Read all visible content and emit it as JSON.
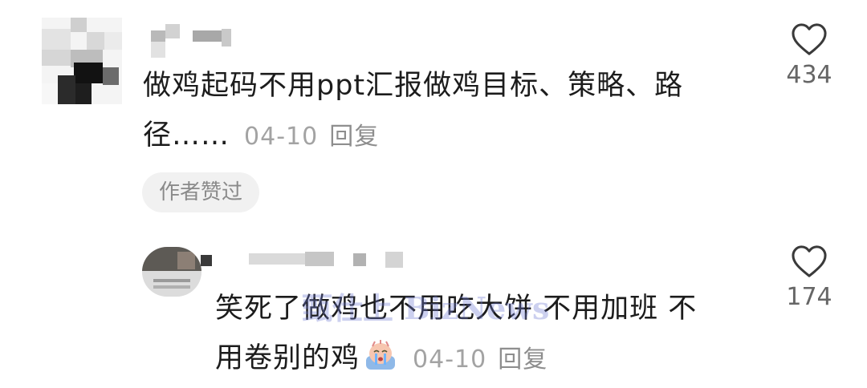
{
  "comments": [
    {
      "text": "做鸡起码不用ppt汇报做鸡目标、策略、路径……",
      "text_line1": "做鸡起码不用ppt汇报做鸡目标、策略、路",
      "text_line2": "径……",
      "date": "04-10",
      "reply_label": "回复",
      "likes": "434",
      "badge": "作者赞过"
    },
    {
      "text_line1": "笑死了做鸡也不用吃大饼 不用加班 不",
      "text_line2": "用卷别的鸡",
      "emoji": "crying-face-emoji",
      "date": "04-10",
      "reply_label": "回复",
      "likes": "174"
    }
  ],
  "watermark": "甄仕上 BizNews",
  "colors": {
    "text": "#1c1c1c",
    "meta": "#a3a3a3",
    "badge_bg": "#f1f1f1"
  }
}
